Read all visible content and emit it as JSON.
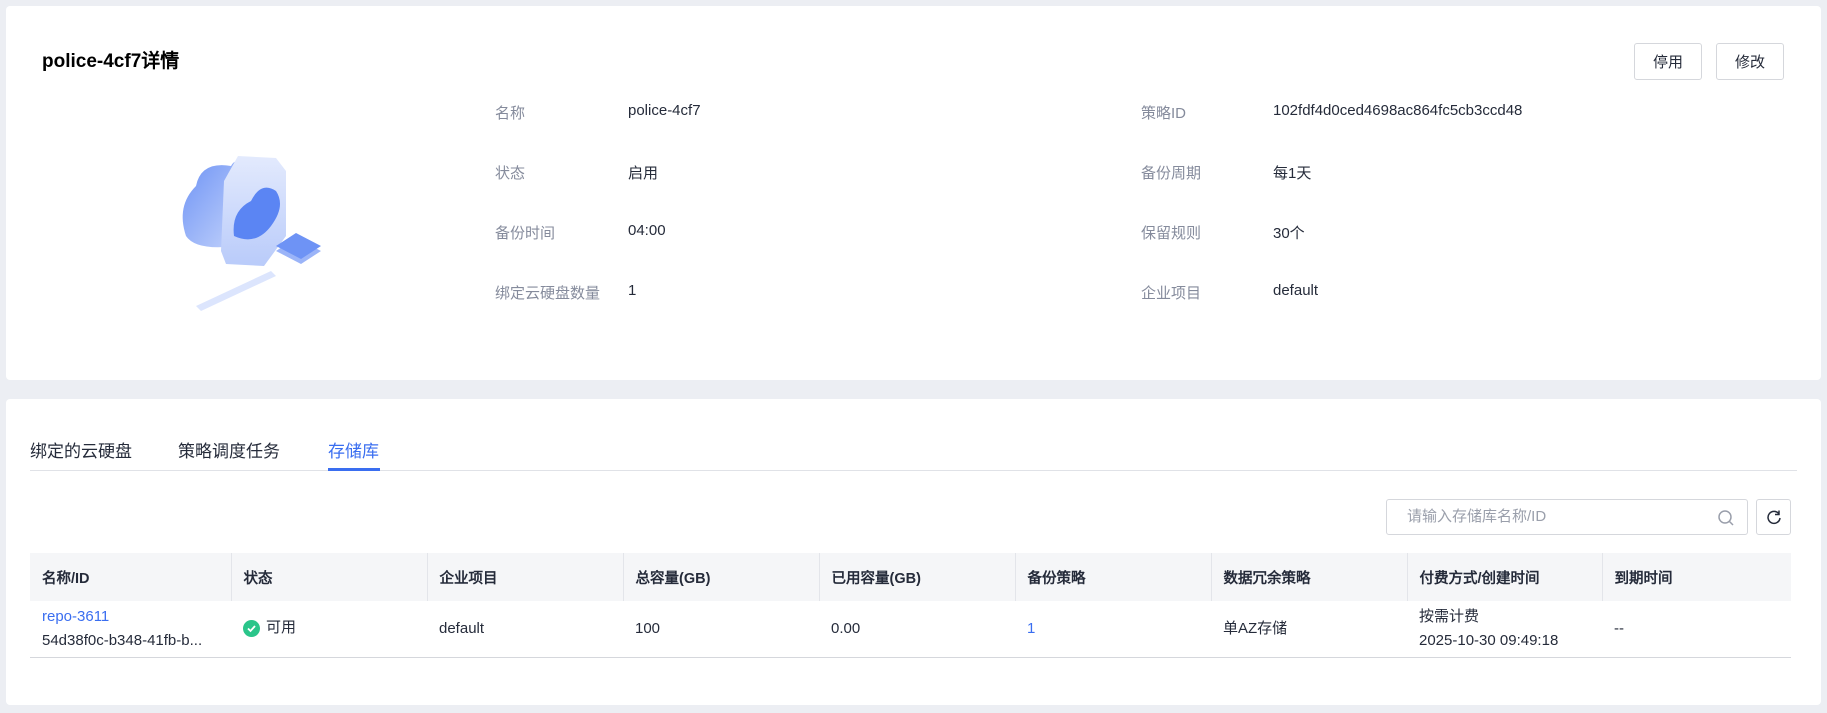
{
  "header": {
    "title": "police-4cf7详情",
    "disable_label": "停用",
    "edit_label": "修改"
  },
  "details": [
    {
      "label": "名称",
      "value": "police-4cf7"
    },
    {
      "label": "策略ID",
      "value": "102fdf4d0ced4698ac864fc5cb3ccd48"
    },
    {
      "label": "状态",
      "value": "启用"
    },
    {
      "label": "备份周期",
      "value": "每1天"
    },
    {
      "label": "备份时间",
      "value": "04:00"
    },
    {
      "label": "保留规则",
      "value": "30个"
    },
    {
      "label": "绑定云硬盘数量",
      "value": "1"
    },
    {
      "label": "企业项目",
      "value": "default"
    }
  ],
  "tabs": [
    "绑定的云硬盘",
    "策略调度任务",
    "存储库"
  ],
  "search": {
    "placeholder": "请输入存储库名称/ID"
  },
  "table": {
    "columns": [
      "名称/ID",
      "状态",
      "企业项目",
      "总容量(GB)",
      "已用容量(GB)",
      "备份策略",
      "数据冗余策略",
      "付费方式/创建时间",
      "到期时间"
    ],
    "rows": [
      {
        "name": "repo-3611",
        "id": "54d38f0c-b348-41fb-b...",
        "status": "可用",
        "project": "default",
        "total": "100",
        "used": "0.00",
        "policy": "1",
        "redundancy": "单AZ存储",
        "billing": "按需计费",
        "created": "2025-10-30 09:49:18",
        "expire": "--"
      }
    ]
  },
  "colors": {
    "accent": "#3a6ef0",
    "ok": "#2ac58a"
  }
}
